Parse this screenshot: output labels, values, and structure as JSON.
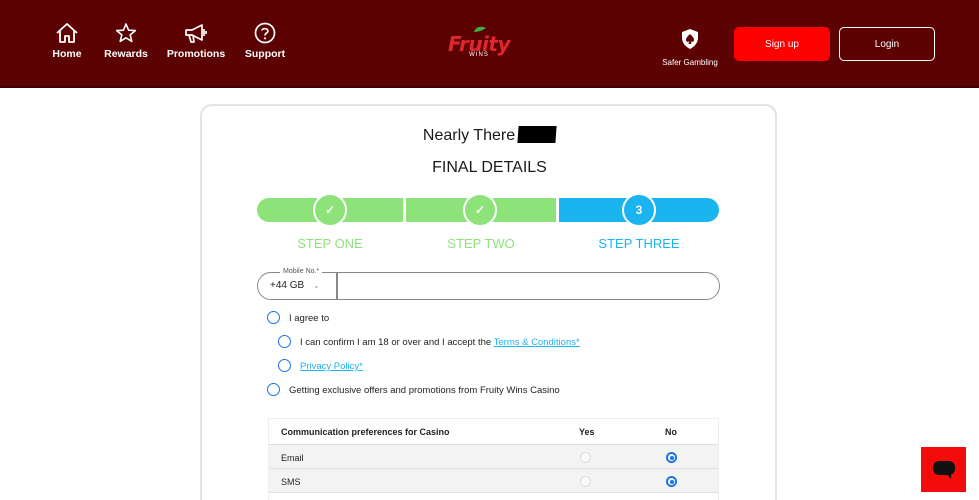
{
  "header": {
    "nav": [
      {
        "label": "Home",
        "icon": "home-icon"
      },
      {
        "label": "Rewards",
        "icon": "star-icon"
      },
      {
        "label": "Promotions",
        "icon": "megaphone-icon"
      },
      {
        "label": "Support",
        "icon": "help-icon"
      }
    ],
    "logo": {
      "text": "Fruity",
      "subtext": "WINS"
    },
    "safer_gambling": {
      "label": "Safer Gambling",
      "icon": "spade-shield-icon"
    },
    "signup_label": "Sign up",
    "login_label": "Login",
    "colors": {
      "background": "#5c0202",
      "signup": "#ff0000"
    }
  },
  "form": {
    "heading": "Nearly There",
    "subheading": "FINAL DETAILS",
    "steps": [
      {
        "number": "✓",
        "label": "STEP ONE",
        "status": "done"
      },
      {
        "number": "✓",
        "label": "STEP TWO",
        "status": "done"
      },
      {
        "number": "3",
        "label": "STEP THREE",
        "status": "current"
      }
    ],
    "colors": {
      "done": "#8ee27a",
      "current": "#1ab4f0"
    },
    "phone": {
      "legend": "Mobile No.*",
      "country_code": "+44 GB",
      "value": ""
    },
    "consents": {
      "agree": "I agree to",
      "age_confirm": "I can confirm I am 18 or over and I accept the",
      "terms_link": "Terms & Conditions*",
      "privacy_link": "Privacy Policy*",
      "offers": "Getting exclusive offers and promotions from Fruity Wins Casino"
    },
    "prefs": {
      "title": "Communication preferences for Casino",
      "yes_label": "Yes",
      "no_label": "No",
      "rows": [
        {
          "label": "Email",
          "selected": "No"
        },
        {
          "label": "SMS",
          "selected": "No"
        }
      ]
    }
  },
  "chat": {
    "icon": "chat-bubble-icon"
  }
}
